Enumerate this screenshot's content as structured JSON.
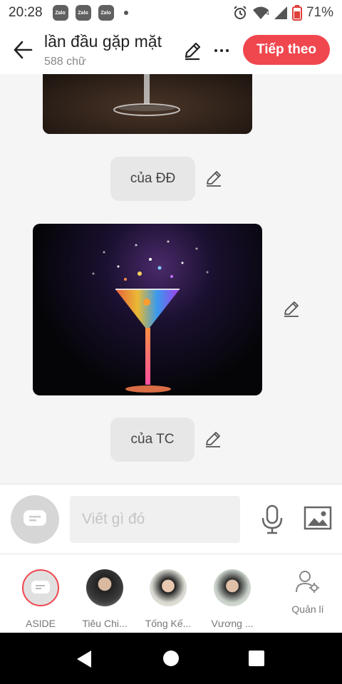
{
  "status_bar": {
    "time": "20:28",
    "app_badges": [
      "Zalo",
      "Zalo",
      "Zalo"
    ],
    "battery": "71%",
    "signal_label": "4"
  },
  "header": {
    "title": "lần đầu gặp mặt",
    "subtitle": "588 chữ",
    "next_label": "Tiếp theo"
  },
  "messages": [
    {
      "type": "image",
      "description_icon": "wine-glass-image"
    },
    {
      "type": "caption",
      "text": "của ĐĐ"
    },
    {
      "type": "image",
      "description_icon": "cocktail-splash-image"
    },
    {
      "type": "caption",
      "text": "của TC"
    }
  ],
  "composer": {
    "placeholder": "Viết gì đó"
  },
  "characters": [
    {
      "name": "ASIDE"
    },
    {
      "name": "Tiêu Chi..."
    },
    {
      "name": "Tống Kế..."
    },
    {
      "name": "Vương ..."
    }
  ],
  "manage_label": "Quản lí",
  "colors": {
    "accent": "#f0464e",
    "background": "#f5f5f5",
    "caption_bg": "#e7e7e7"
  }
}
